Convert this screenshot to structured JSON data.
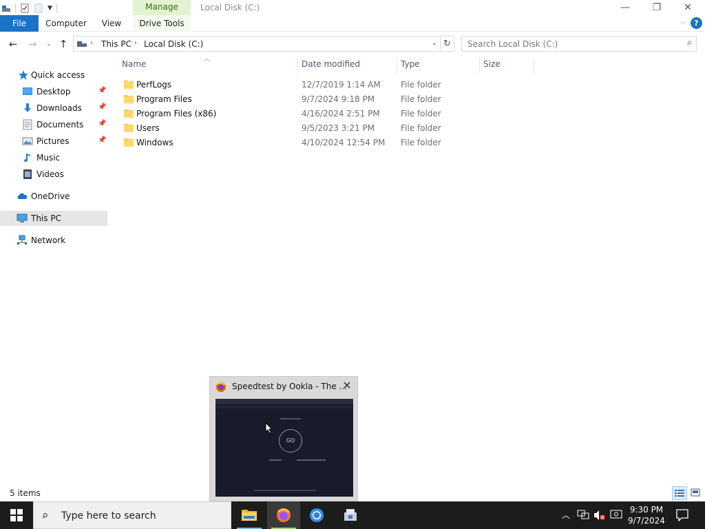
{
  "window": {
    "title": "Local Disk (C:)",
    "context_tab": "Manage",
    "controls": {
      "minimize": "—",
      "restore": "❐",
      "close": "✕"
    }
  },
  "ribbon": {
    "tabs": [
      "File",
      "Computer",
      "View",
      "Drive Tools"
    ],
    "help": "?"
  },
  "address": {
    "crumbs": [
      "This PC",
      "Local Disk (C:)"
    ],
    "search_placeholder": "Search Local Disk (C:)"
  },
  "nav": {
    "quick_access": "Quick access",
    "items": [
      {
        "label": "Desktop",
        "pinned": true
      },
      {
        "label": "Downloads",
        "pinned": true
      },
      {
        "label": "Documents",
        "pinned": true
      },
      {
        "label": "Pictures",
        "pinned": true
      },
      {
        "label": "Music",
        "pinned": false
      },
      {
        "label": "Videos",
        "pinned": false
      }
    ],
    "onedrive": "OneDrive",
    "thispc": "This PC",
    "network": "Network"
  },
  "columns": {
    "name": "Name",
    "date": "Date modified",
    "type": "Type",
    "size": "Size"
  },
  "files": [
    {
      "name": "PerfLogs",
      "date": "12/7/2019 1:14 AM",
      "type": "File folder"
    },
    {
      "name": "Program Files",
      "date": "9/7/2024 9:18 PM",
      "type": "File folder"
    },
    {
      "name": "Program Files (x86)",
      "date": "4/16/2024 2:51 PM",
      "type": "File folder"
    },
    {
      "name": "Users",
      "date": "9/5/2023 3:21 PM",
      "type": "File folder"
    },
    {
      "name": "Windows",
      "date": "4/10/2024 12:54 PM",
      "type": "File folder"
    }
  ],
  "status": {
    "items": "5 items"
  },
  "thumbnail": {
    "title": "Speedtest by Ookla - The ...",
    "go": "GO"
  },
  "taskbar": {
    "search_placeholder": "Type here to search",
    "time": "9:30 PM",
    "date": "9/7/2024"
  },
  "colors": {
    "accent": "#1a73c7",
    "manage_bg": "#e3f2d0",
    "taskbar": "#1c1c1c",
    "folder": "#f5c84c"
  }
}
